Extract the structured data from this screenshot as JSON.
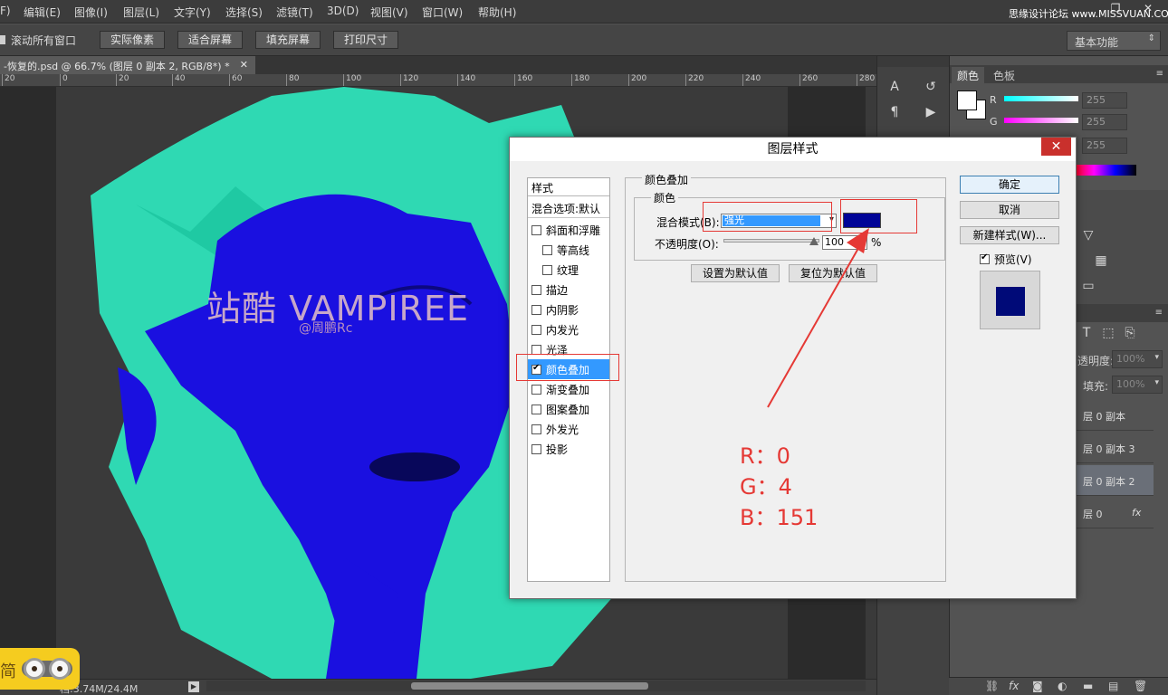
{
  "menu": {
    "items": [
      "F)",
      "编辑(E)",
      "图像(I)",
      "图层(L)",
      "文字(Y)",
      "选择(S)",
      "滤镜(T)",
      "3D(D)",
      "视图(V)",
      "窗口(W)",
      "帮助(H)"
    ],
    "watermark": "思缘设计论坛 www.MISSVUAN.COM"
  },
  "options": {
    "scroll_all_label": "滚动所有窗口",
    "actual_pixels": "实际像素",
    "fit_screen": "适合屏幕",
    "fill_screen": "填充屏幕",
    "print_size": "打印尺寸",
    "workspace": "基本功能"
  },
  "document": {
    "tab_title": "-恢复的.psd @ 66.7% (图层 0 副本 2, RGB/8*) *",
    "ruler_ticks": [
      "20",
      "0",
      "20",
      "40",
      "60",
      "80",
      "100",
      "120",
      "140",
      "160",
      "180",
      "200",
      "220",
      "240",
      "260",
      "280"
    ],
    "status": "档:3.74M/24.4M"
  },
  "canvas": {
    "title": "站酷 VAMPIREE",
    "subtitle": "@周鹏Rc"
  },
  "badge": {
    "char": "简"
  },
  "color_panel": {
    "tabs": [
      "颜色",
      "色板"
    ],
    "channels": [
      {
        "label": "R",
        "value": "255"
      },
      {
        "label": "G",
        "value": "255"
      },
      {
        "label": "",
        "value": "255"
      }
    ]
  },
  "layers_panel": {
    "opacity_label": "透明度:",
    "opacity_value": "100%",
    "fill_label": "填充:",
    "fill_value": "100%",
    "layers": [
      {
        "name": "层 0 副本"
      },
      {
        "name": "层 0 副本 3"
      },
      {
        "name": "层 0 副本 2"
      },
      {
        "name": "层 0"
      }
    ],
    "fx": "fx"
  },
  "dialog": {
    "title": "图层样式",
    "styles_header": "样式",
    "blend_options": "混合选项:默认",
    "style_items": [
      {
        "label": "斜面和浮雕",
        "checked": false,
        "sub": false
      },
      {
        "label": "等高线",
        "checked": false,
        "sub": true
      },
      {
        "label": "纹理",
        "checked": false,
        "sub": true
      },
      {
        "label": "描边",
        "checked": false,
        "sub": false
      },
      {
        "label": "内阴影",
        "checked": false,
        "sub": false
      },
      {
        "label": "内发光",
        "checked": false,
        "sub": false
      },
      {
        "label": "光泽",
        "checked": false,
        "sub": false
      },
      {
        "label": "颜色叠加",
        "checked": true,
        "sub": false
      },
      {
        "label": "渐变叠加",
        "checked": false,
        "sub": false
      },
      {
        "label": "图案叠加",
        "checked": false,
        "sub": false
      },
      {
        "label": "外发光",
        "checked": false,
        "sub": false
      },
      {
        "label": "投影",
        "checked": false,
        "sub": false
      }
    ],
    "section_title": "颜色叠加",
    "group_title": "颜色",
    "blend_mode_label": "混合模式(B):",
    "blend_mode_value": "强光",
    "overlay_color": "#000497",
    "opacity_label": "不透明度(O):",
    "opacity_value": "100",
    "percent": "%",
    "make_default": "设置为默认值",
    "reset_default": "复位为默认值",
    "ok": "确定",
    "cancel": "取消",
    "new_style": "新建样式(W)...",
    "preview_label": "预览(V)",
    "preview_checked": true
  },
  "annotation": {
    "r": "R：0",
    "g": "G：4",
    "b": "B：151",
    "color": "#e53935"
  }
}
